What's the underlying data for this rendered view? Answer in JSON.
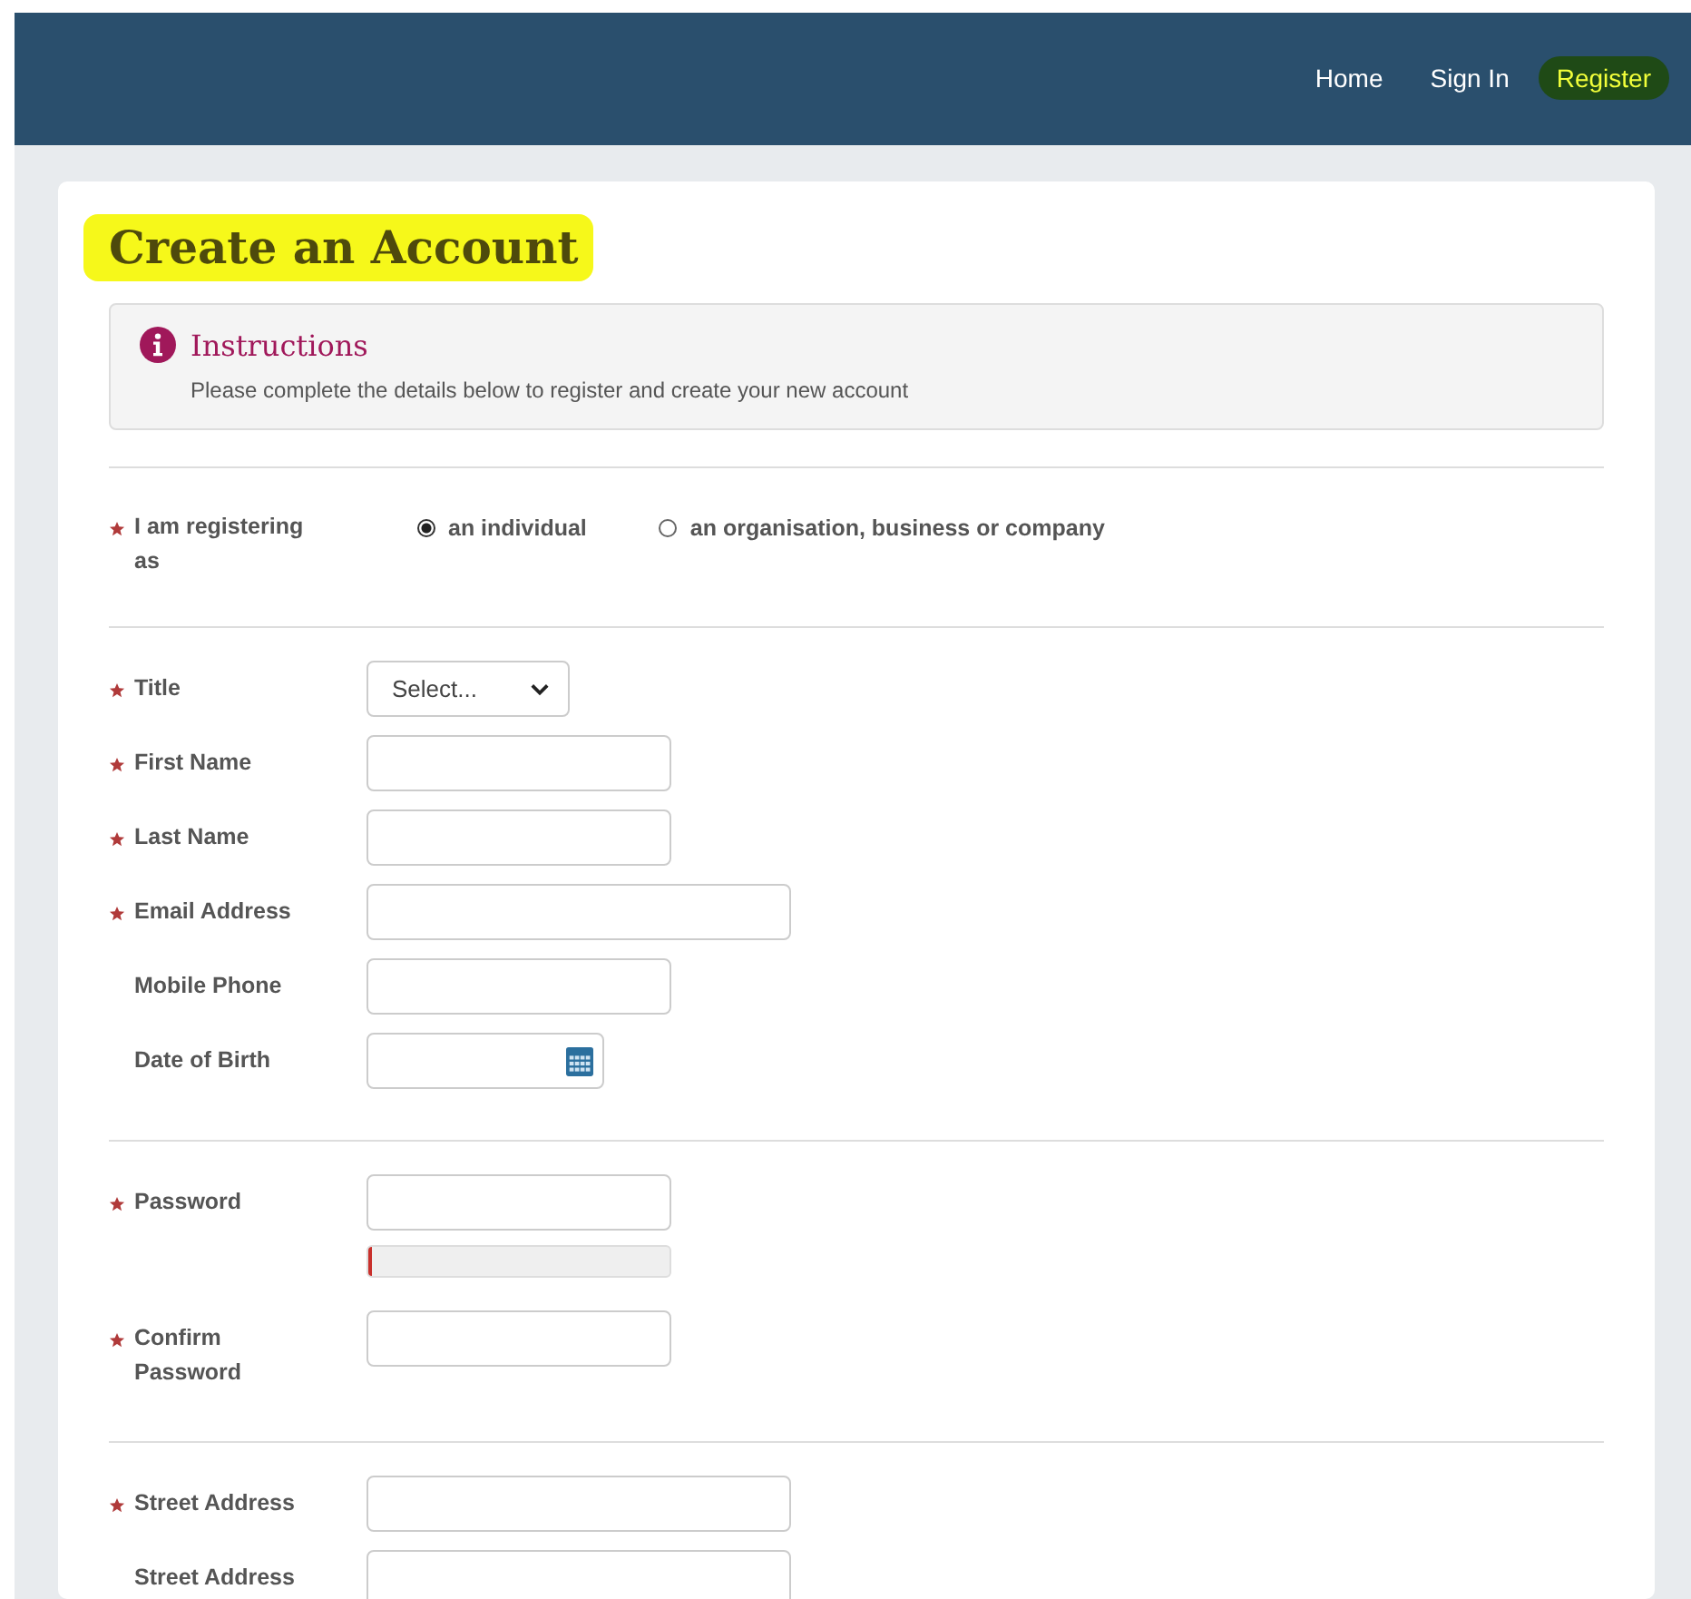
{
  "nav": {
    "links": [
      {
        "label": "Home",
        "highlighted": false
      },
      {
        "label": "Sign In",
        "highlighted": false
      },
      {
        "label": "Register",
        "highlighted": true
      }
    ]
  },
  "page": {
    "title": "Create an Account",
    "title_highlighted": true
  },
  "instructions": {
    "heading": "Instructions",
    "text": "Please complete the details below to register and create your new account"
  },
  "registering_as": {
    "label": "I am registering as",
    "required": true,
    "options": [
      {
        "label": "an individual",
        "selected": true
      },
      {
        "label": "an organisation, business or company",
        "selected": false
      }
    ]
  },
  "sections": [
    {
      "rows": [
        {
          "label": "Title",
          "required": true,
          "kind": "select",
          "value": "Select..."
        },
        {
          "label": "First Name",
          "required": true,
          "kind": "text"
        },
        {
          "label": "Last Name",
          "required": true,
          "kind": "text"
        },
        {
          "label": "Email Address",
          "required": true,
          "kind": "wide"
        },
        {
          "label": "Mobile Phone",
          "required": false,
          "kind": "text"
        },
        {
          "label": "Date of Birth",
          "required": false,
          "kind": "date"
        }
      ]
    },
    {
      "rows": [
        {
          "label": "Password",
          "required": true,
          "kind": "password",
          "level": 0.01
        },
        {
          "label": "Confirm Password",
          "required": true,
          "kind": "text"
        }
      ]
    },
    {
      "rows": [
        {
          "label": "Street Address",
          "required": true,
          "kind": "wide"
        },
        {
          "label": "Street Address",
          "required": false,
          "kind": "wide"
        }
      ]
    }
  ]
}
